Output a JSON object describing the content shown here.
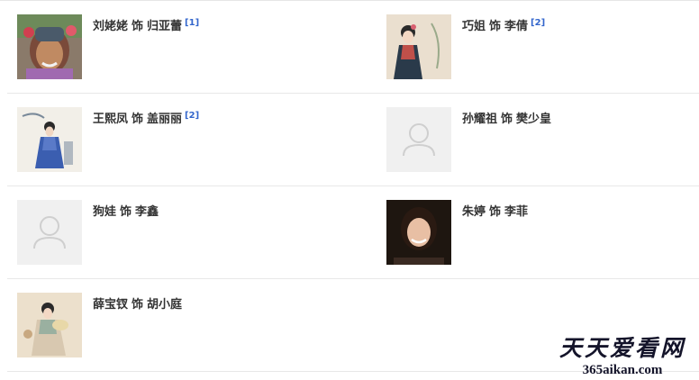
{
  "separator": "饰",
  "cast": [
    {
      "actor": "刘姥姥",
      "role": "归亚蕾",
      "citation": "[1]",
      "photo": "portrait-photo-granny"
    },
    {
      "actor": "巧姐",
      "role": "李倩",
      "citation": "[2]",
      "photo": "painting-girl"
    },
    {
      "actor": "王熙凤",
      "role": "盖丽丽",
      "citation": "[2]",
      "photo": "painting-lady-blue"
    },
    {
      "actor": "孙耀祖",
      "role": "樊少皇",
      "citation": "",
      "photo": "avatar-placeholder"
    },
    {
      "actor": "狗娃",
      "role": "李鑫",
      "citation": "",
      "photo": "avatar-placeholder"
    },
    {
      "actor": "朱婷",
      "role": "李菲",
      "citation": "",
      "photo": "portrait-photo-actress"
    },
    {
      "actor": "薛宝钗",
      "role": "胡小庭",
      "citation": "",
      "photo": "painting-lady-fan"
    }
  ],
  "watermark": {
    "title": "天天爱看网",
    "url": "365aikan.com"
  }
}
